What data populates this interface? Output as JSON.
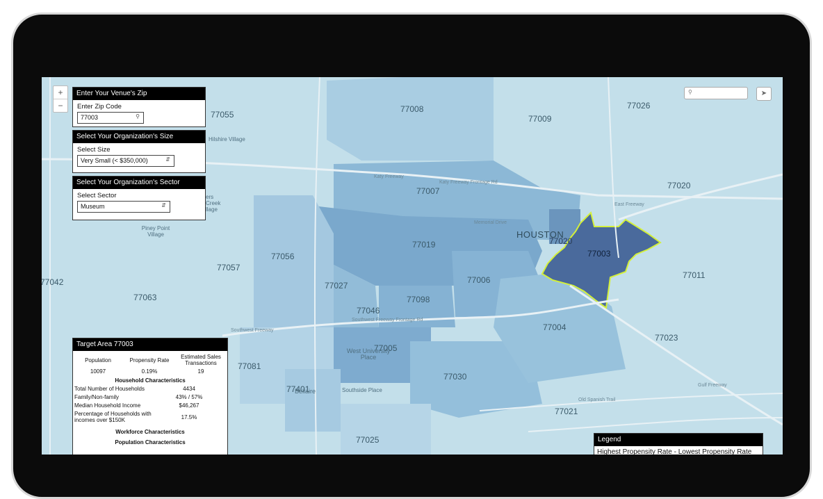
{
  "map": {
    "zip_labels": [
      "77055",
      "77008",
      "77009",
      "77026",
      "77007",
      "77020",
      "77019",
      "77003",
      "77056",
      "77057",
      "77006",
      "77011",
      "77027",
      "77098",
      "77046",
      "77063",
      "77004",
      "77023",
      "77005",
      "77030",
      "77081",
      "77401",
      "77021",
      "77025"
    ],
    "place_labels": [
      "Hilshire Village",
      "Piney Point Village",
      "HOUSTON",
      "West University Place",
      "Bellaire",
      "Southside Place",
      "77020",
      "ers Creek llage",
      "77042"
    ],
    "road_labels": [
      "Katy Freeway",
      "Katy Freeway Frontage Rd",
      "Southwest Freeway",
      "Southwest Freeway Frontage Rd",
      "Old Spanish Trail",
      "Gulf Freeway",
      "East Freeway",
      "Memorial Drive"
    ],
    "highlight_color": "#4a6a9c",
    "outline_color": "#d4f03a"
  },
  "zoom": {
    "in": "+",
    "out": "−"
  },
  "zip_panel": {
    "title": "Enter Your Venue's Zip",
    "label": "Enter Zip Code",
    "value": "77003",
    "icon": "search-icon"
  },
  "size_panel": {
    "title": "Select Your Organization's Size",
    "label": "Select Size",
    "value": "Very Small (< $350,000)",
    "icon": "select-arrows-icon"
  },
  "sector_panel": {
    "title": "Select Your Organization's Sector",
    "label": "Select Sector",
    "value": "Museum",
    "icon": "select-arrows-icon"
  },
  "map_search": {
    "icon": "search-icon"
  },
  "locate": {
    "icon": "send-arrow-icon"
  },
  "target_area": {
    "title": "Target Area 77003",
    "headers": [
      "Population",
      "Propensity Rate",
      "Estimated Sales Transactions"
    ],
    "values": [
      "10097",
      "0.19%",
      "19"
    ],
    "household_title": "Household Characteristics",
    "household": [
      {
        "label": "Total Number of Households",
        "value": "4434"
      },
      {
        "label": "Family/Non-family",
        "value": "43% / 57%"
      },
      {
        "label": "Median Household Income",
        "value": "$46,267"
      },
      {
        "label": "Percentage of Households with incomes over $150K",
        "value": "17.5%"
      }
    ],
    "workforce_title": "Workforce Characteristics",
    "population_title": "Population Characteristics"
  },
  "legend": {
    "title": "Legend",
    "text": "Highest Propensity Rate - Lowest Propensity Rate"
  }
}
